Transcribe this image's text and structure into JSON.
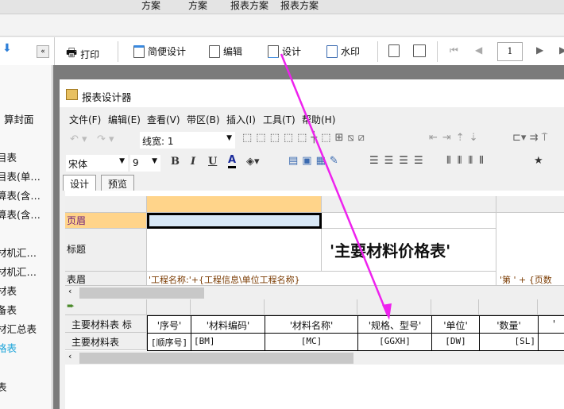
{
  "top_tabs": [
    "方案",
    "方案",
    "报表方案",
    "报表方案"
  ],
  "toolbar": {
    "print": "打印",
    "simple_design": "简便设计",
    "edit": "编辑",
    "design": "设计",
    "watermark": "水印",
    "page_value": "1"
  },
  "sidebar": {
    "items": [
      {
        "label": "算封面",
        "active": false
      },
      {
        "label": "目表",
        "active": false
      },
      {
        "label": "目表(单…",
        "active": false
      },
      {
        "label": "算表(含…",
        "active": false
      },
      {
        "label": "算表(含…",
        "active": false
      },
      {
        "label": "材机汇…",
        "active": false
      },
      {
        "label": "材机汇…",
        "active": false
      },
      {
        "label": "材表",
        "active": false
      },
      {
        "label": "备表",
        "active": false
      },
      {
        "label": "材汇总表",
        "active": false
      },
      {
        "label": "格表",
        "active": true
      },
      {
        "label": "表",
        "active": false
      }
    ],
    "active_color": "#1aa3d9"
  },
  "designer": {
    "title": "报表设计器",
    "menu": [
      "文件(F)",
      "编辑(E)",
      "查看(V)",
      "带区(B)",
      "插入(I)",
      "工具(T)",
      "帮助(H)"
    ],
    "line_width_label": "线宽:",
    "line_width_value": "1",
    "font_name": "宋体",
    "font_size": "9",
    "tabs": [
      "设计",
      "预览"
    ],
    "bands": {
      "page_header": "页眉",
      "title": "标题",
      "table_header": "表眉"
    },
    "title_text": "'主要材料价格表'",
    "table_header_left": "'工程名称:'+{工程信息\\单位工程名称}",
    "table_header_right": "'第 ' + {页数",
    "detail": {
      "header_label": "主要材料表 标",
      "row_label": "主要材料表",
      "headers": [
        "'序号'",
        "'材料编码'",
        "'材料名称'",
        "'规格、型号'",
        "'单位'",
        "'数量'",
        "'"
      ],
      "fields": [
        "[顺序号]",
        "[BM]",
        "[MC]",
        "[GGXH]",
        "[DW]",
        "[SL]",
        ""
      ]
    }
  },
  "colors": {
    "band_highlight": "#ffd48a",
    "selected_cell": "#d8e8f6",
    "annotation_arrow": "#ee22ee"
  }
}
